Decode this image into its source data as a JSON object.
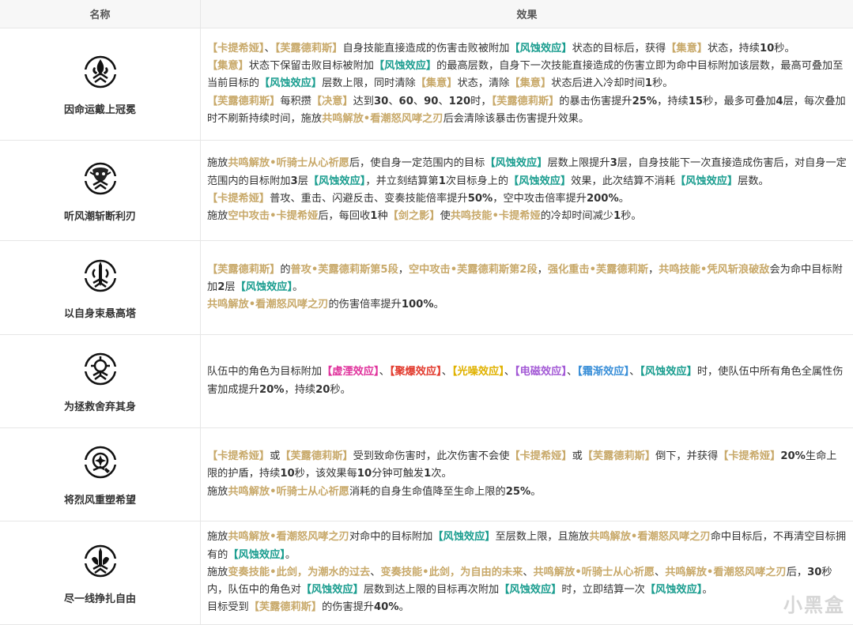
{
  "header": {
    "name": "名称",
    "effect": "效果"
  },
  "colors": {
    "gold": "#c8a96a",
    "aero": "#1a9d8f",
    "havoc": "#e0329c",
    "fusion": "#e23b2e",
    "spectro": "#e0b200",
    "electro": "#a45bd6",
    "glacio": "#3a8fd8"
  },
  "rows": [
    {
      "name": "因命运戴上冠冕",
      "icon": "fleur-crown-icon",
      "lines": [
        [
          [
            "c",
            "【卡提希娅】"
          ],
          [
            "t",
            "、"
          ],
          [
            "c",
            "【芙露德莉斯】"
          ],
          [
            "t",
            "自身技能直接造成的伤害击败被附加"
          ],
          [
            "g",
            "【风蚀效应】"
          ],
          [
            "t",
            "状态的目标后，获得"
          ],
          [
            "c",
            "【集意】"
          ],
          [
            "t",
            "状态，持续"
          ],
          [
            "b",
            "10"
          ],
          [
            "t",
            "秒。"
          ]
        ],
        [
          [
            "c",
            "【集意】"
          ],
          [
            "t",
            "状态下保留击败目标被附加"
          ],
          [
            "g",
            "【风蚀效应】"
          ],
          [
            "t",
            "的最高层数，自身下一次技能直接造成的伤害立即为命中目标附加该层数，最高可叠加至当前目标的"
          ],
          [
            "g",
            "【风蚀效应】"
          ],
          [
            "t",
            "层数上限，同时清除"
          ],
          [
            "c",
            "【集意】"
          ],
          [
            "t",
            "状态，清除"
          ],
          [
            "c",
            "【集意】"
          ],
          [
            "t",
            "状态后进入冷却时间"
          ],
          [
            "b",
            "1"
          ],
          [
            "t",
            "秒。"
          ]
        ],
        [
          [
            "c",
            "【芙露德莉斯】"
          ],
          [
            "t",
            "每积攒"
          ],
          [
            "c",
            "【决意】"
          ],
          [
            "t",
            "达到"
          ],
          [
            "b",
            "30"
          ],
          [
            "t",
            "、"
          ],
          [
            "b",
            "60"
          ],
          [
            "t",
            "、"
          ],
          [
            "b",
            "90"
          ],
          [
            "t",
            "、"
          ],
          [
            "b",
            "120"
          ],
          [
            "t",
            "时，"
          ],
          [
            "c",
            "【芙露德莉斯】"
          ],
          [
            "t",
            "的暴击伤害提升"
          ],
          [
            "b",
            "25%"
          ],
          [
            "t",
            "，持续"
          ],
          [
            "b",
            "15"
          ],
          [
            "t",
            "秒，最多可叠加"
          ],
          [
            "b",
            "4"
          ],
          [
            "t",
            "层，每次叠加时不刷新持续时间，施放"
          ],
          [
            "c",
            "共鸣解放•看潮怒风哮之刃"
          ],
          [
            "t",
            "后会清除该暴击伤害提升效果。"
          ]
        ]
      ]
    },
    {
      "name": "听风潮斩断利刃",
      "icon": "beast-emblem-icon",
      "lines": [
        [
          [
            "t",
            "施放"
          ],
          [
            "c",
            "共鸣解放•听骑士从心祈愿"
          ],
          [
            "t",
            "后，使自身一定范围内的目标"
          ],
          [
            "g",
            "【风蚀效应】"
          ],
          [
            "t",
            "层数上限提升"
          ],
          [
            "b",
            "3"
          ],
          [
            "t",
            "层，自身技能下一次直接造成伤害后，对自身一定范围内的目标附加"
          ],
          [
            "b",
            "3"
          ],
          [
            "t",
            "层"
          ],
          [
            "g",
            "【风蚀效应】"
          ],
          [
            "t",
            "，并立刻结算第"
          ],
          [
            "b",
            "1"
          ],
          [
            "t",
            "次目标身上的"
          ],
          [
            "g",
            "【风蚀效应】"
          ],
          [
            "t",
            "效果，此次结算不消耗"
          ],
          [
            "g",
            "【风蚀效应】"
          ],
          [
            "t",
            "层数。"
          ]
        ],
        [
          [
            "c",
            "【卡提希娅】"
          ],
          [
            "t",
            "普攻、重击、闪避反击、变奏技能倍率提升"
          ],
          [
            "b",
            "50%"
          ],
          [
            "t",
            "，空中攻击倍率提升"
          ],
          [
            "b",
            "200%"
          ],
          [
            "t",
            "。"
          ]
        ],
        [
          [
            "t",
            "施放"
          ],
          [
            "c",
            "空中攻击•卡提希娅"
          ],
          [
            "t",
            "后，每回收"
          ],
          [
            "b",
            "1"
          ],
          [
            "t",
            "种"
          ],
          [
            "c",
            "【剑之影】"
          ],
          [
            "t",
            "使"
          ],
          [
            "c",
            "共鸣技能•卡提希娅"
          ],
          [
            "t",
            "的冷却时间减少"
          ],
          [
            "b",
            "1"
          ],
          [
            "t",
            "秒。"
          ]
        ]
      ]
    },
    {
      "name": "以自身束悬高塔",
      "icon": "sword-tower-icon",
      "lines": [
        [
          [
            "c",
            "【芙露德莉斯】"
          ],
          [
            "t",
            "的"
          ],
          [
            "c",
            "普攻•芙露德莉斯第5段"
          ],
          [
            "t",
            "，"
          ],
          [
            "c",
            "空中攻击•芙露德莉斯第2段"
          ],
          [
            "t",
            "，"
          ],
          [
            "c",
            "强化重击•芙露德莉斯"
          ],
          [
            "t",
            "，"
          ],
          [
            "c",
            "共鸣技能•凭风斩浪破敌"
          ],
          [
            "t",
            "会为命中目标附加"
          ],
          [
            "b",
            "2"
          ],
          [
            "t",
            "层"
          ],
          [
            "g",
            "【风蚀效应】"
          ],
          [
            "t",
            "。"
          ]
        ],
        [
          [
            "c",
            "共鸣解放•看潮怒风哮之刃"
          ],
          [
            "t",
            "的伤害倍率提升"
          ],
          [
            "b",
            "100%"
          ],
          [
            "t",
            "。"
          ]
        ]
      ]
    },
    {
      "name": "为拯救舍弃其身",
      "icon": "ring-sigil-icon",
      "lines": [
        [
          [
            "t",
            "队伍中的角色为目标附加"
          ],
          [
            "m",
            "【虚湮效应】"
          ],
          [
            "t",
            "、"
          ],
          [
            "r",
            "【聚爆效应】"
          ],
          [
            "t",
            "、"
          ],
          [
            "y",
            "【光噪效应】"
          ],
          [
            "t",
            "、"
          ],
          [
            "p",
            "【电磁效应】"
          ],
          [
            "t",
            "、"
          ],
          [
            "u",
            "【霜渐效应】"
          ],
          [
            "t",
            "、"
          ],
          [
            "g",
            "【风蚀效应】"
          ],
          [
            "t",
            "时，使队伍中所有角色全属性伤害加成提升"
          ],
          [
            "b",
            "20%"
          ],
          [
            "t",
            "，持续"
          ],
          [
            "b",
            "20"
          ],
          [
            "t",
            "秒。"
          ]
        ]
      ]
    },
    {
      "name": "将烈风重塑希望",
      "icon": "compass-star-icon",
      "lines": [
        [
          [
            "c",
            "【卡提希娅】"
          ],
          [
            "t",
            "或"
          ],
          [
            "c",
            "【芙露德莉斯】"
          ],
          [
            "t",
            "受到致命伤害时，此次伤害不会使"
          ],
          [
            "c",
            "【卡提希娅】"
          ],
          [
            "t",
            "或"
          ],
          [
            "c",
            "【芙露德莉斯】"
          ],
          [
            "t",
            "倒下，并获得"
          ],
          [
            "c",
            "【卡提希娅】"
          ],
          [
            "b",
            "20%"
          ],
          [
            "t",
            "生命上限的护盾，持续"
          ],
          [
            "b",
            "10"
          ],
          [
            "t",
            "秒，该效果每"
          ],
          [
            "b",
            "10"
          ],
          [
            "t",
            "分钟可触发"
          ],
          [
            "b",
            "1"
          ],
          [
            "t",
            "次。"
          ]
        ],
        [
          [
            "t",
            "施放"
          ],
          [
            "c",
            "共鸣解放•听骑士从心祈愿"
          ],
          [
            "t",
            "消耗的自身生命值降至生命上限的"
          ],
          [
            "b",
            "25%"
          ],
          [
            "t",
            "。"
          ]
        ]
      ]
    },
    {
      "name": "尽一线挣扎自由",
      "icon": "hand-sword-icon",
      "lines": [
        [
          [
            "t",
            "施放"
          ],
          [
            "c",
            "共鸣解放•看潮怒风哮之刃"
          ],
          [
            "t",
            "对命中的目标附加"
          ],
          [
            "g",
            "【风蚀效应】"
          ],
          [
            "t",
            "至层数上限，且施放"
          ],
          [
            "c",
            "共鸣解放•看潮怒风哮之刃"
          ],
          [
            "t",
            "命中目标后，不再清空目标拥有的"
          ],
          [
            "g",
            "【风蚀效应】"
          ],
          [
            "t",
            "。"
          ]
        ],
        [
          [
            "t",
            "施放"
          ],
          [
            "c",
            "变奏技能•此剑，为潮水的过去"
          ],
          [
            "t",
            "、"
          ],
          [
            "c",
            "变奏技能•此剑，为自由的未来"
          ],
          [
            "t",
            "、"
          ],
          [
            "c",
            "共鸣解放•听骑士从心祈愿"
          ],
          [
            "t",
            "、"
          ],
          [
            "c",
            "共鸣解放•看潮怒风哮之刃"
          ],
          [
            "t",
            "后，"
          ],
          [
            "b",
            "30"
          ],
          [
            "t",
            "秒内，队伍中的角色对"
          ],
          [
            "g",
            "【风蚀效应】"
          ],
          [
            "t",
            "层数到达上限的目标再次附加"
          ],
          [
            "g",
            "【风蚀效应】"
          ],
          [
            "t",
            "时，立即结算一次"
          ],
          [
            "g",
            "【风蚀效应】"
          ],
          [
            "t",
            "。"
          ]
        ],
        [
          [
            "t",
            "目标受到"
          ],
          [
            "c",
            "【芙露德莉斯】"
          ],
          [
            "t",
            "的伤害提升"
          ],
          [
            "b",
            "40%"
          ],
          [
            "t",
            "。"
          ]
        ]
      ]
    }
  ],
  "watermark": "小黑盒"
}
